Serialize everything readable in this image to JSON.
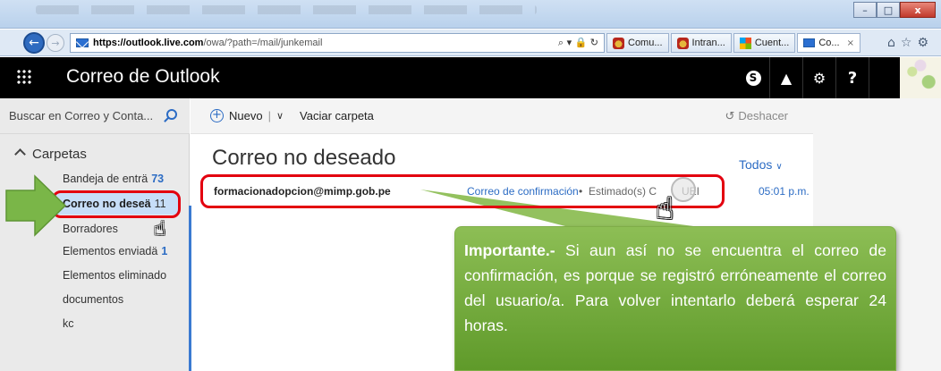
{
  "browser": {
    "url_host": "https://outlook.live.com",
    "url_path": "/owa/?path=/mail/junkemail",
    "url_icons": "⌕ ▾ 🔒 ↻",
    "tabs": [
      {
        "label": "Comu...",
        "icon": "crest-icon"
      },
      {
        "label": "Intran...",
        "icon": "crest-icon"
      },
      {
        "label": "Cuent...",
        "icon": "microsoft-icon"
      },
      {
        "label": "Co...",
        "icon": "mail-icon"
      }
    ],
    "tab_close": "×",
    "window_buttons": {
      "minimize": "–",
      "maximize": "□",
      "close": "x"
    },
    "right_icons": "⌂☆⚙"
  },
  "header": {
    "title": "Correo de Outlook",
    "icons": [
      "skype-icon",
      "bell-icon",
      "gear-icon",
      "help-icon"
    ],
    "skype_label": "S",
    "bell_glyph": "▲",
    "gear_glyph": "⚙",
    "help_glyph": "?"
  },
  "search": {
    "placeholder": "Buscar en Correo y Conta..."
  },
  "commands": {
    "new_label": "Nuevo",
    "new_plus": "+",
    "divider": "|",
    "chevron": "∨",
    "empty_folder_label": "Vaciar carpeta",
    "undo_icon": "↺",
    "undo_label": "Deshacer"
  },
  "folders": {
    "header": "Carpetas",
    "items": [
      {
        "label": "Bandeja de enträ",
        "count": "73"
      },
      {
        "label": "Correo no deseä",
        "count": "11",
        "selected": true
      },
      {
        "label": "Borradores",
        "count": ""
      },
      {
        "label": "Elementos enviadä",
        "count": "1"
      },
      {
        "label": "Elementos eliminado",
        "count": ""
      },
      {
        "label": "documentos",
        "count": ""
      },
      {
        "label": "kc",
        "count": ""
      }
    ]
  },
  "message_list": {
    "title": "Correo no deseado",
    "filter_label": "Todos",
    "filter_chevron": "∨",
    "messages": [
      {
        "from": "formacionadopcion@mimp.gob.pe",
        "subject": "Correo de confirmación",
        "separator": "•",
        "preview": "Estimado(s) C",
        "preview_tail": "UEI",
        "time": "05:01 p.m."
      }
    ]
  },
  "annotation": {
    "callout_bold": "Importante.-",
    "callout_text": " Si aun así no se encuentra el correo de confirmación, es porque se registró erróneamente el correo del usuario/a. Para volver intentarlo deberá esperar 24 horas.",
    "highlight_color": "#e3000f",
    "callout_color": "#6ea63a",
    "arrow_color": "#7ab648",
    "cursor_glyph": "☝"
  },
  "colors": {
    "accent": "#2c6cc4",
    "header_bg": "#000000",
    "selected_folder": "#c7def8"
  }
}
